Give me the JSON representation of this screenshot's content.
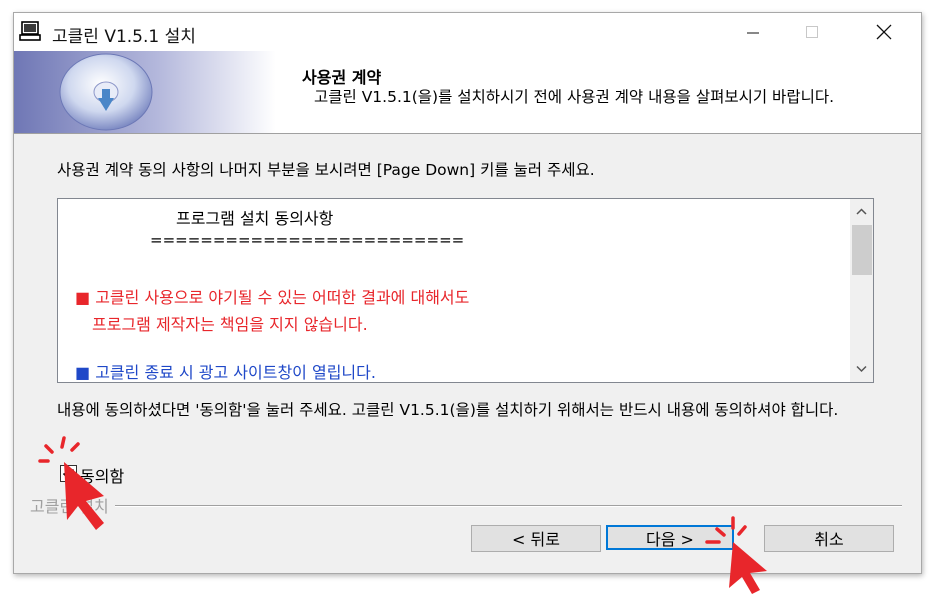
{
  "window": {
    "title": "고클린 V1.5.1 설치",
    "icon": "installer-computer-icon",
    "controls": [
      "minimize-icon",
      "maximize-icon",
      "close-icon"
    ]
  },
  "header": {
    "title": "사용권 계약",
    "subtitle": "고클린 V1.5.1(을)를 설치하시기 전에 사용권 계약 내용을 살펴보시기 바랍니다."
  },
  "instruction": "사용권 계약 동의 사항의 나머지 부분을 보시려면 [Page Down] 키를 눌러 주세요.",
  "license": {
    "heading": "프로그램 설치 동의사항",
    "divider": "=========================",
    "item1_line1": "■ 고클린 사용으로 야기될 수 있는 어떠한 결과에 대해서도",
    "item1_line2": "프로그램 제작자는 책임을 지지 않습니다.",
    "item2": "■ 고클린 종료 시 광고 사이트창이 열립니다."
  },
  "agree_text": "내용에 동의하셨다면 '동의함'을 눌러 주세요. 고클린 V1.5.1(을)를 설치하기 위해서는 반드시 내용에 동의하셔야 합니다.",
  "checkbox": {
    "label": "동의함",
    "checked": true
  },
  "brand_label": "고클린 설치",
  "buttons": {
    "back": "< 뒤로",
    "next": "다음 >",
    "cancel": "취소"
  },
  "colors": {
    "red_text": "#e8262b",
    "blue_text": "#1f48c8",
    "focus_border": "#0078d7",
    "annotation": "#e8262b"
  }
}
